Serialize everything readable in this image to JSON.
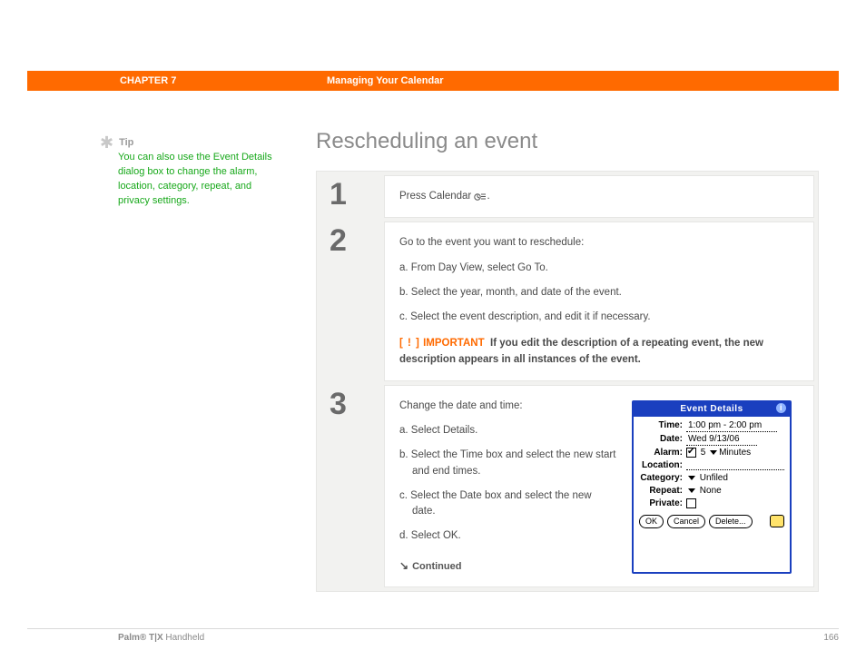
{
  "header": {
    "chapter": "CHAPTER 7",
    "title": "Managing Your Calendar"
  },
  "sidebar": {
    "tip_label": "Tip",
    "tip_body": "You can also use the Event Details dialog box to change the alarm, location, category, repeat, and privacy settings."
  },
  "section_title": "Rescheduling an event",
  "steps": {
    "s1": {
      "num": "1",
      "text": "Press Calendar "
    },
    "s2": {
      "num": "2",
      "intro": "Go to the event you want to reschedule:",
      "a": "a.  From Day View, select Go To.",
      "b": "b.  Select the year, month, and date of the event.",
      "c": "c.  Select the event description, and edit it if necessary.",
      "important_markers": "[ ! ]",
      "important_label": "IMPORTANT",
      "important_text": "If you edit the description of a repeating event, the new description appears in all instances of the event."
    },
    "s3": {
      "num": "3",
      "intro": "Change the date and time:",
      "a": "a.  Select Details.",
      "b": "b.  Select the Time box and select the new start and end times.",
      "c": "c.  Select the Date box and select the new date.",
      "d": "d.  Select OK.",
      "continued": "Continued"
    }
  },
  "dialog": {
    "title": "Event Details",
    "labels": {
      "time": "Time:",
      "date": "Date:",
      "alarm": "Alarm:",
      "location": "Location:",
      "category": "Category:",
      "repeat": "Repeat:",
      "private": "Private:"
    },
    "time_value": "1:00 pm - 2:00 pm",
    "date_value": "Wed 9/13/06",
    "alarm_value": "5",
    "alarm_unit": "Minutes",
    "category_value": "Unfiled",
    "repeat_value": "None",
    "ok": "OK",
    "cancel": "Cancel",
    "delete": "Delete..."
  },
  "footer": {
    "product": "Palm® T|X",
    "suffix": " Handheld",
    "page": "166"
  }
}
